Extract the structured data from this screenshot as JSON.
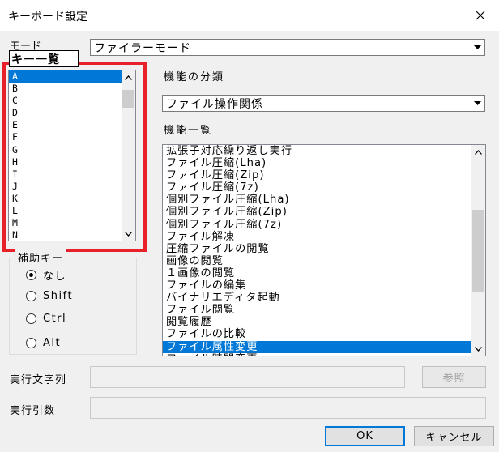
{
  "window": {
    "title": "キーボード設定",
    "close_glyph": "✕"
  },
  "mode": {
    "label": "モード",
    "value": "ファイラーモード"
  },
  "key_list": {
    "header": "キー一覧",
    "items": [
      "A",
      "B",
      "C",
      "D",
      "E",
      "F",
      "G",
      "H",
      "I",
      "J",
      "K",
      "L",
      "M",
      "N"
    ],
    "selected_index": 0
  },
  "modifier": {
    "label": "補助キー",
    "options": [
      {
        "label": "なし",
        "checked": true
      },
      {
        "label": "Shift",
        "checked": false
      },
      {
        "label": "Ctrl",
        "checked": false
      },
      {
        "label": "Alt",
        "checked": false
      }
    ]
  },
  "category": {
    "label": "機能の分類",
    "value": "ファイル操作関係"
  },
  "function_list": {
    "label": "機能一覧",
    "items": [
      "拡張子対応繰り返し実行",
      "ファイル圧縮(Lha)",
      "ファイル圧縮(Zip)",
      "ファイル圧縮(7z)",
      "個別ファイル圧縮(Lha)",
      "個別ファイル圧縮(Zip)",
      "個別ファイル圧縮(7z)",
      "ファイル解凍",
      "圧縮ファイルの閲覧",
      "画像の閲覧",
      "１画像の閲覧",
      "ファイルの編集",
      "バイナリエディタ起動",
      "ファイル閲覧",
      "閲覧履歴",
      "ファイルの比較",
      "ファイル属性変更",
      "ファイル時間変更"
    ],
    "selected_index": 16
  },
  "exec_string": {
    "label": "実行文字列",
    "value": ""
  },
  "exec_args": {
    "label": "実行引数",
    "value": ""
  },
  "buttons": {
    "browse": "参照",
    "ok": "OK",
    "cancel": "キャンセル"
  },
  "colors": {
    "selection": "#0078d7",
    "highlight_box": "#e8202a",
    "background": "#f0f0f0"
  }
}
